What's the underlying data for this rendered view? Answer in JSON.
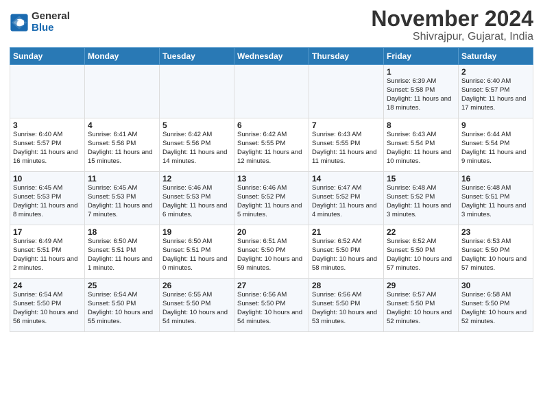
{
  "header": {
    "logo_line1": "General",
    "logo_line2": "Blue",
    "title": "November 2024",
    "subtitle": "Shivrajpur, Gujarat, India"
  },
  "columns": [
    "Sunday",
    "Monday",
    "Tuesday",
    "Wednesday",
    "Thursday",
    "Friday",
    "Saturday"
  ],
  "weeks": [
    [
      {
        "day": "",
        "info": ""
      },
      {
        "day": "",
        "info": ""
      },
      {
        "day": "",
        "info": ""
      },
      {
        "day": "",
        "info": ""
      },
      {
        "day": "",
        "info": ""
      },
      {
        "day": "1",
        "info": "Sunrise: 6:39 AM\nSunset: 5:58 PM\nDaylight: 11 hours and 18 minutes."
      },
      {
        "day": "2",
        "info": "Sunrise: 6:40 AM\nSunset: 5:57 PM\nDaylight: 11 hours and 17 minutes."
      }
    ],
    [
      {
        "day": "3",
        "info": "Sunrise: 6:40 AM\nSunset: 5:57 PM\nDaylight: 11 hours and 16 minutes."
      },
      {
        "day": "4",
        "info": "Sunrise: 6:41 AM\nSunset: 5:56 PM\nDaylight: 11 hours and 15 minutes."
      },
      {
        "day": "5",
        "info": "Sunrise: 6:42 AM\nSunset: 5:56 PM\nDaylight: 11 hours and 14 minutes."
      },
      {
        "day": "6",
        "info": "Sunrise: 6:42 AM\nSunset: 5:55 PM\nDaylight: 11 hours and 12 minutes."
      },
      {
        "day": "7",
        "info": "Sunrise: 6:43 AM\nSunset: 5:55 PM\nDaylight: 11 hours and 11 minutes."
      },
      {
        "day": "8",
        "info": "Sunrise: 6:43 AM\nSunset: 5:54 PM\nDaylight: 11 hours and 10 minutes."
      },
      {
        "day": "9",
        "info": "Sunrise: 6:44 AM\nSunset: 5:54 PM\nDaylight: 11 hours and 9 minutes."
      }
    ],
    [
      {
        "day": "10",
        "info": "Sunrise: 6:45 AM\nSunset: 5:53 PM\nDaylight: 11 hours and 8 minutes."
      },
      {
        "day": "11",
        "info": "Sunrise: 6:45 AM\nSunset: 5:53 PM\nDaylight: 11 hours and 7 minutes."
      },
      {
        "day": "12",
        "info": "Sunrise: 6:46 AM\nSunset: 5:53 PM\nDaylight: 11 hours and 6 minutes."
      },
      {
        "day": "13",
        "info": "Sunrise: 6:46 AM\nSunset: 5:52 PM\nDaylight: 11 hours and 5 minutes."
      },
      {
        "day": "14",
        "info": "Sunrise: 6:47 AM\nSunset: 5:52 PM\nDaylight: 11 hours and 4 minutes."
      },
      {
        "day": "15",
        "info": "Sunrise: 6:48 AM\nSunset: 5:52 PM\nDaylight: 11 hours and 3 minutes."
      },
      {
        "day": "16",
        "info": "Sunrise: 6:48 AM\nSunset: 5:51 PM\nDaylight: 11 hours and 3 minutes."
      }
    ],
    [
      {
        "day": "17",
        "info": "Sunrise: 6:49 AM\nSunset: 5:51 PM\nDaylight: 11 hours and 2 minutes."
      },
      {
        "day": "18",
        "info": "Sunrise: 6:50 AM\nSunset: 5:51 PM\nDaylight: 11 hours and 1 minute."
      },
      {
        "day": "19",
        "info": "Sunrise: 6:50 AM\nSunset: 5:51 PM\nDaylight: 11 hours and 0 minutes."
      },
      {
        "day": "20",
        "info": "Sunrise: 6:51 AM\nSunset: 5:50 PM\nDaylight: 10 hours and 59 minutes."
      },
      {
        "day": "21",
        "info": "Sunrise: 6:52 AM\nSunset: 5:50 PM\nDaylight: 10 hours and 58 minutes."
      },
      {
        "day": "22",
        "info": "Sunrise: 6:52 AM\nSunset: 5:50 PM\nDaylight: 10 hours and 57 minutes."
      },
      {
        "day": "23",
        "info": "Sunrise: 6:53 AM\nSunset: 5:50 PM\nDaylight: 10 hours and 57 minutes."
      }
    ],
    [
      {
        "day": "24",
        "info": "Sunrise: 6:54 AM\nSunset: 5:50 PM\nDaylight: 10 hours and 56 minutes."
      },
      {
        "day": "25",
        "info": "Sunrise: 6:54 AM\nSunset: 5:50 PM\nDaylight: 10 hours and 55 minutes."
      },
      {
        "day": "26",
        "info": "Sunrise: 6:55 AM\nSunset: 5:50 PM\nDaylight: 10 hours and 54 minutes."
      },
      {
        "day": "27",
        "info": "Sunrise: 6:56 AM\nSunset: 5:50 PM\nDaylight: 10 hours and 54 minutes."
      },
      {
        "day": "28",
        "info": "Sunrise: 6:56 AM\nSunset: 5:50 PM\nDaylight: 10 hours and 53 minutes."
      },
      {
        "day": "29",
        "info": "Sunrise: 6:57 AM\nSunset: 5:50 PM\nDaylight: 10 hours and 52 minutes."
      },
      {
        "day": "30",
        "info": "Sunrise: 6:58 AM\nSunset: 5:50 PM\nDaylight: 10 hours and 52 minutes."
      }
    ]
  ]
}
